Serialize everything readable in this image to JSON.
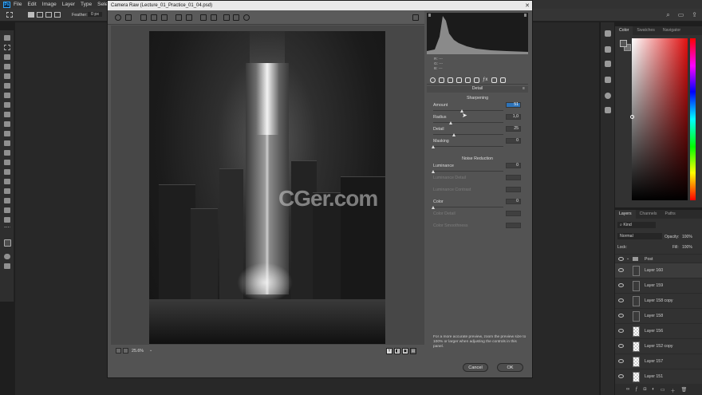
{
  "menubar": {
    "logo": "Ps",
    "items": [
      "File",
      "Edit",
      "Image",
      "Layer",
      "Type",
      "Select"
    ]
  },
  "options": {
    "feather_label": "Feather:",
    "feather_value": "0 px"
  },
  "dialog": {
    "title": "Camera Raw (Lecture_01_Practice_01_04.psd)",
    "zoom": "25.6%",
    "panel_title": "Detail",
    "sharpening": {
      "header": "Sharpening",
      "sliders": [
        {
          "label": "Amount",
          "value": "51",
          "highlight": true
        },
        {
          "label": "Radius",
          "value": "1,0"
        },
        {
          "label": "Detail",
          "value": "25"
        },
        {
          "label": "Masking",
          "value": "0"
        }
      ]
    },
    "noise": {
      "header": "Noise Reduction",
      "sliders": [
        {
          "label": "Luminance",
          "value": "0",
          "enabled": true
        },
        {
          "label": "Luminance Detail",
          "value": "",
          "enabled": false
        },
        {
          "label": "Luminance Contrast",
          "value": "",
          "enabled": false
        },
        {
          "label": "Color",
          "value": "0",
          "enabled": true
        },
        {
          "label": "Color Detail",
          "value": "",
          "enabled": false
        },
        {
          "label": "Color Smoothness",
          "value": "",
          "enabled": false
        }
      ]
    },
    "rgb_readout": [
      "R:   ---",
      "G:   ---",
      "B:   ---"
    ],
    "note": "For a more accurate preview, zoom the preview size to 100% or larger when adjusting the controls in this panel.",
    "cancel_label": "Cancel",
    "ok_label": "OK",
    "view_buttons": [
      "Y",
      "◧",
      "▣",
      "▤"
    ]
  },
  "color_panel": {
    "tabs": [
      "Color",
      "Swatches",
      "Navigator"
    ],
    "active_tab": "Color"
  },
  "layers_panel": {
    "tabs": [
      "Layers",
      "Channels",
      "Paths"
    ],
    "filter": "Kind",
    "blend_mode": "Normal",
    "opacity_label": "Opacity:",
    "opacity_value": "100%",
    "lock_label": "Lock:",
    "fill_label": "Fill:",
    "fill_value": "100%",
    "layers": [
      {
        "name": "Post",
        "type": "group"
      },
      {
        "name": "Layer 160",
        "type": "dark",
        "selected": true
      },
      {
        "name": "Layer 159",
        "type": "dark"
      },
      {
        "name": "Layer 158 copy",
        "type": "dark"
      },
      {
        "name": "Layer 158",
        "type": "dark"
      },
      {
        "name": "Layer 156",
        "type": "checker"
      },
      {
        "name": "Layer 152 copy",
        "type": "checker"
      },
      {
        "name": "Layer 157",
        "type": "checker"
      },
      {
        "name": "Layer 151",
        "type": "checker"
      }
    ]
  },
  "watermark": "CGer.com",
  "colors": {
    "accent_blue": "#2e73b8",
    "hue_red": "#e01010"
  }
}
